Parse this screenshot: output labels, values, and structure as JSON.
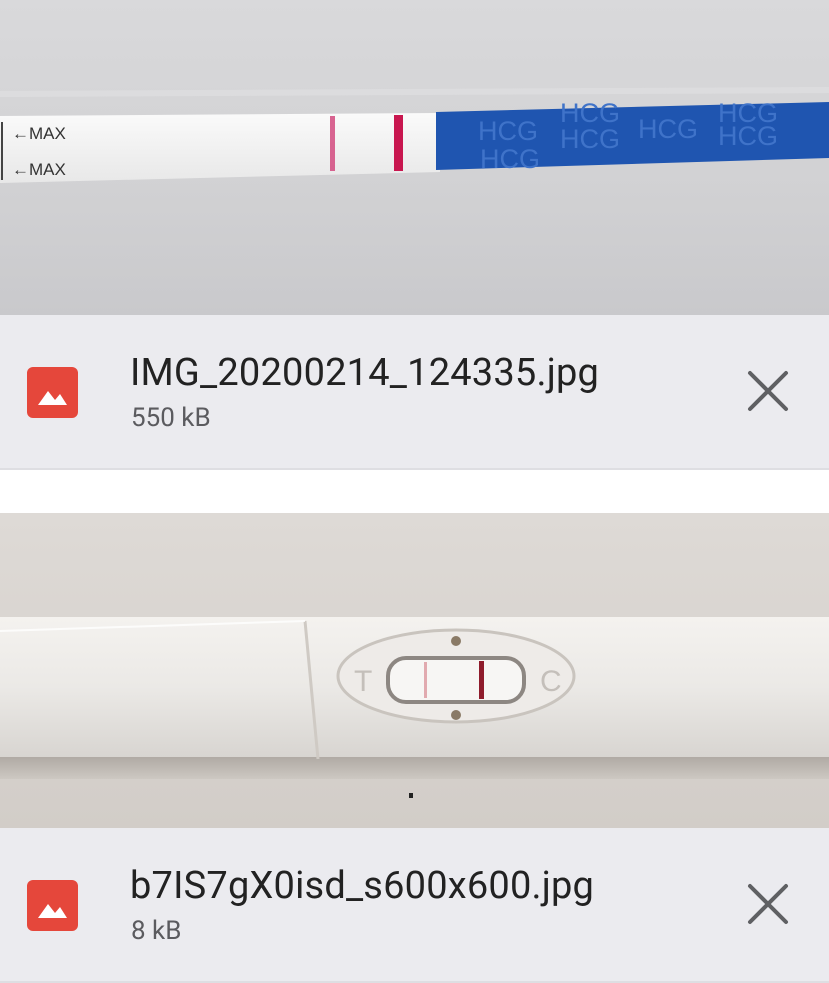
{
  "attachments": [
    {
      "preview": {
        "strip_labels": [
          "←MAX",
          "←MAX"
        ],
        "brand_text": "HCG",
        "colors": {
          "background": "#d5d5d7",
          "strip": "#f3f3f3",
          "handle": "#1f55b0",
          "test_line": "#cc2f6b",
          "control_line": "#c8164f"
        }
      },
      "file_type_icon": "image-icon",
      "file_name": "IMG_20200214_124335.jpg",
      "file_size": "550 kB",
      "remove_icon": "close-icon"
    },
    {
      "preview": {
        "window_labels": [
          "T",
          "C"
        ],
        "colors": {
          "background": "#d9d5d1",
          "casing": "#ebe9e6",
          "control_line": "#8f1c2c",
          "test_line": "#d78a92"
        }
      },
      "file_type_icon": "image-icon",
      "file_name": "b7IS7gX0isd_s600x600.jpg",
      "file_size": "8 kB",
      "remove_icon": "close-icon"
    }
  ],
  "accent_color": "#e5473b"
}
